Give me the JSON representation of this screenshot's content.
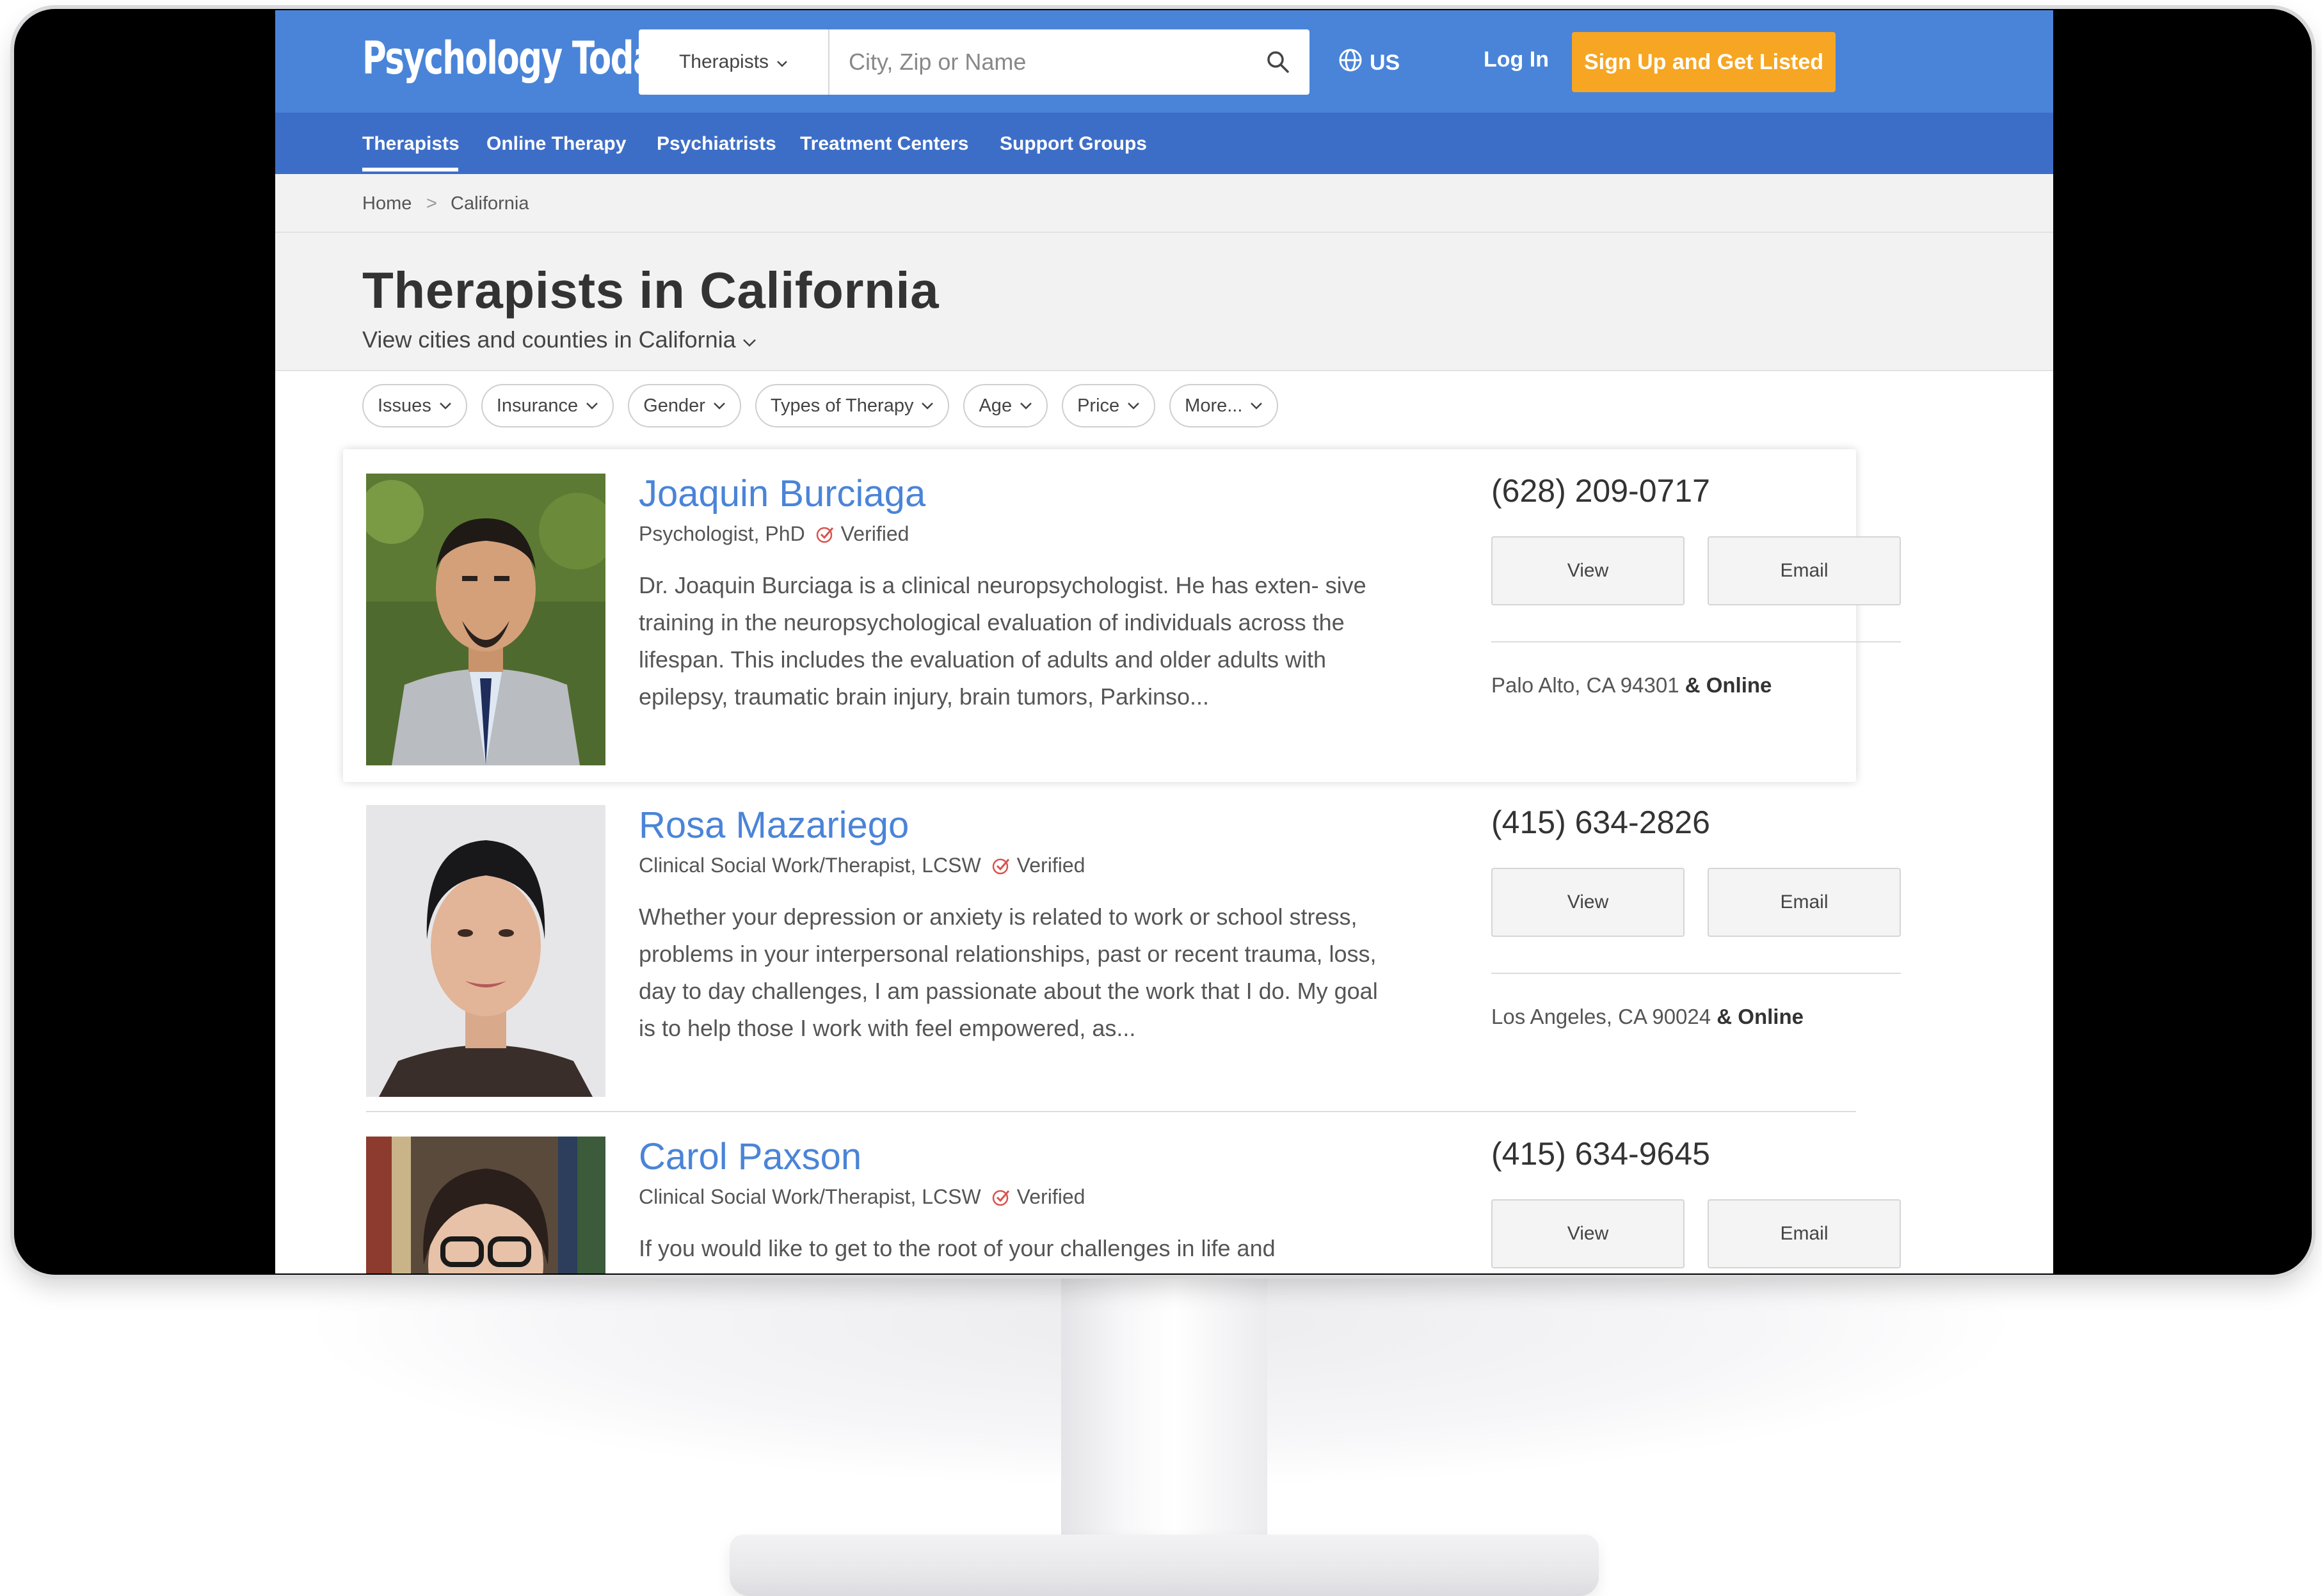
{
  "header": {
    "logo": "Psychology Today",
    "search_type": "Therapists",
    "search_placeholder": "City, Zip or Name",
    "region": "US",
    "login": "Log In",
    "signup": "Sign Up and Get Listed"
  },
  "nav": [
    "Therapists",
    "Online Therapy",
    "Psychiatrists",
    "Treatment Centers",
    "Support Groups"
  ],
  "breadcrumb": {
    "home": "Home",
    "sep": ">",
    "current": "California"
  },
  "page": {
    "title": "Therapists in California",
    "cities_link": "View cities and counties in California"
  },
  "filters": [
    "Issues",
    "Insurance",
    "Gender",
    "Types of Therapy",
    "Age",
    "Price",
    "More..."
  ],
  "listings": [
    {
      "name": "Joaquin Burciaga",
      "credential": "Psychologist, PhD",
      "verified": "Verified",
      "bio": "Dr. Joaquin Burciaga is a clinical neuropsychologist. He has exten- sive training in the neuropsychological evaluation of individuals across the lifespan. This includes the evaluation of adults and older adults with epilepsy, traumatic brain injury, brain tumors, Parkinso...",
      "phone": "(628) 209-0717",
      "view": "View",
      "email": "Email",
      "location": "Palo Alto, CA 94301",
      "online": "& Online"
    },
    {
      "name": "Rosa Mazariego",
      "credential": "Clinical Social Work/Therapist, LCSW",
      "verified": "Verified",
      "bio": "Whether your depression or anxiety is related to work or school stress, problems in your interpersonal relationships, past or recent trauma, loss, day to day challenges, I am passionate about the work that I do. My goal is to help those I work with feel empowered, as...",
      "phone": "(415) 634-2826",
      "view": "View",
      "email": "Email",
      "location": "Los Angeles, CA 90024",
      "online": "& Online"
    },
    {
      "name": "Carol Paxson",
      "credential": "Clinical Social Work/Therapist, LCSW",
      "verified": "Verified",
      "bio": "If you would like to get to the root of your challenges in life and",
      "phone": "(415) 634-9645",
      "view": "View",
      "email": "Email"
    }
  ],
  "colors": {
    "brand_blue": "#4a84d8",
    "nav_blue": "#3d6ec7",
    "signup_orange": "#f6a623",
    "verified_red": "#d9534f"
  },
  "icons": [
    "chevron-down-icon",
    "search-icon",
    "globe-icon",
    "verified-check-icon"
  ]
}
